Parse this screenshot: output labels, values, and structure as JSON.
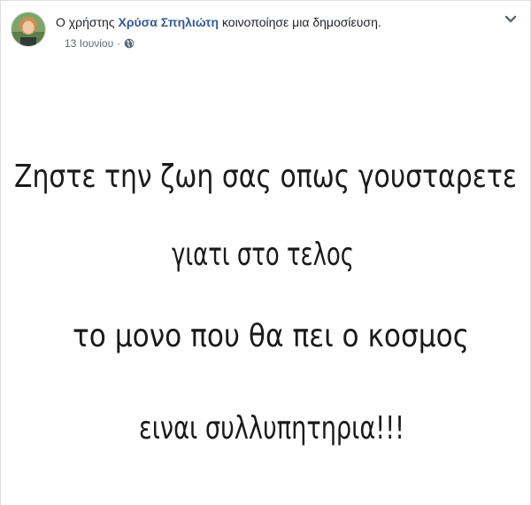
{
  "post": {
    "prefix": "Ο χρήστης",
    "author": "Χρύσα Σπηλιώτη",
    "action": "κοινοποίησε μια δημοσίευση.",
    "date": "13 Ιουνίου",
    "separator": "·",
    "privacy_icon": "globe-icon",
    "menu_icon": "chevron-down-icon"
  },
  "image_text": {
    "line1": "Ζηστε την ζωη σας οπως γουσταρετε",
    "line2": "γιατι στο τελος",
    "line3": "το μονο που θα πει ο κοσμος",
    "line4": "ειναι συλλυπητηρια!!!"
  }
}
